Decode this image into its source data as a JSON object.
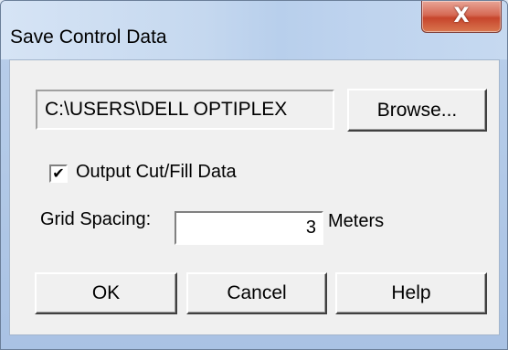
{
  "window": {
    "title": "Save Control Data",
    "close_label": "X"
  },
  "file": {
    "path_value": "C:\\USERS\\DELL OPTIPLEX",
    "browse_label": "Browse..."
  },
  "options": {
    "output_cut_fill_checked": true,
    "output_cut_fill_label": "Output Cut/Fill Data",
    "checkmark": "✔",
    "grid_spacing_label": "Grid Spacing:",
    "grid_spacing_value": "3",
    "grid_spacing_unit": "Meters"
  },
  "buttons": {
    "ok_label": "OK",
    "cancel_label": "Cancel",
    "help_label": "Help"
  },
  "colors": {
    "close_button": "#c7452c",
    "titlebar": "#c5d8ef",
    "client": "#f0f0f0"
  }
}
